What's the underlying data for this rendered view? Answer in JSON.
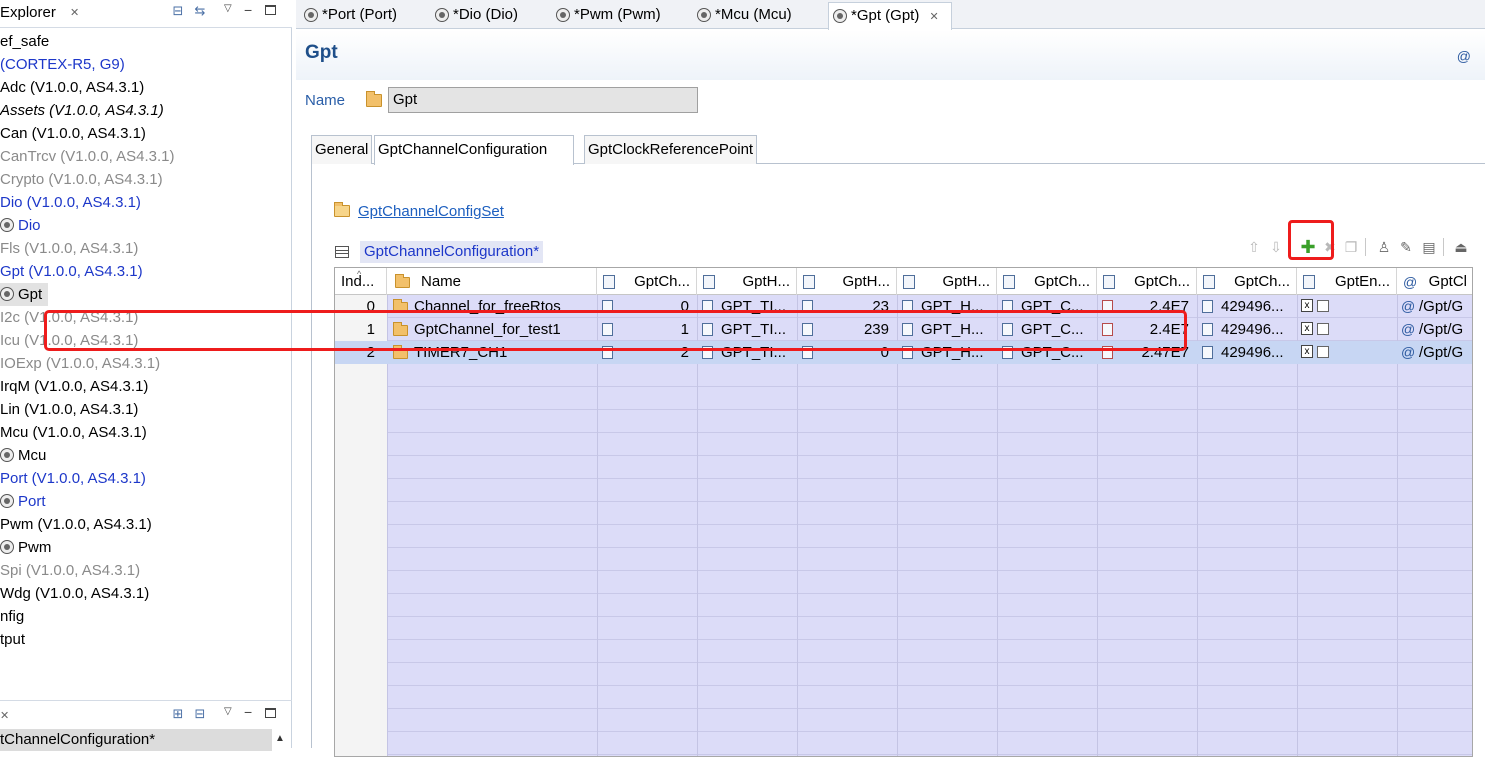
{
  "explorer": {
    "title": "Explorer",
    "items": [
      {
        "label": "ef_safe",
        "color": "black",
        "italic": false,
        "icon": false
      },
      {
        "label": " (CORTEX-R5, G9)",
        "color": "blue",
        "italic": false,
        "icon": false
      },
      {
        "label": "Adc (V1.0.0, AS4.3.1)",
        "color": "black",
        "italic": false,
        "icon": false
      },
      {
        "label": "Assets (V1.0.0, AS4.3.1)",
        "color": "black",
        "italic": true,
        "icon": false
      },
      {
        "label": "Can (V1.0.0, AS4.3.1)",
        "color": "black",
        "italic": false,
        "icon": false
      },
      {
        "label": "CanTrcv (V1.0.0, AS4.3.1)",
        "color": "gray",
        "italic": false,
        "icon": false
      },
      {
        "label": "Crypto (V1.0.0, AS4.3.1)",
        "color": "gray",
        "italic": false,
        "icon": false
      },
      {
        "label": "Dio (V1.0.0, AS4.3.1)",
        "color": "blue",
        "italic": false,
        "icon": false
      },
      {
        "label": "Dio",
        "color": "blue",
        "italic": false,
        "icon": true
      },
      {
        "label": "Fls (V1.0.0, AS4.3.1)",
        "color": "gray",
        "italic": false,
        "icon": false
      },
      {
        "label": "Gpt (V1.0.0, AS4.3.1)",
        "color": "blue",
        "italic": false,
        "icon": false
      },
      {
        "label": "Gpt",
        "color": "black",
        "italic": false,
        "icon": true,
        "selected": true
      },
      {
        "label": "I2c (V1.0.0, AS4.3.1)",
        "color": "gray",
        "italic": false,
        "icon": false
      },
      {
        "label": "Icu (V1.0.0, AS4.3.1)",
        "color": "gray",
        "italic": false,
        "icon": false
      },
      {
        "label": "IOExp (V1.0.0, AS4.3.1)",
        "color": "gray",
        "italic": false,
        "icon": false
      },
      {
        "label": "IrqM (V1.0.0, AS4.3.1)",
        "color": "black",
        "italic": false,
        "icon": false
      },
      {
        "label": "Lin (V1.0.0, AS4.3.1)",
        "color": "black",
        "italic": false,
        "icon": false
      },
      {
        "label": "Mcu (V1.0.0, AS4.3.1)",
        "color": "black",
        "italic": false,
        "icon": false
      },
      {
        "label": "Mcu",
        "color": "black",
        "italic": false,
        "icon": true
      },
      {
        "label": "Port (V1.0.0, AS4.3.1)",
        "color": "blue",
        "italic": false,
        "icon": false
      },
      {
        "label": "Port",
        "color": "blue",
        "italic": false,
        "icon": true
      },
      {
        "label": "Pwm (V1.0.0, AS4.3.1)",
        "color": "black",
        "italic": false,
        "icon": false
      },
      {
        "label": "Pwm",
        "color": "black",
        "italic": false,
        "icon": true
      },
      {
        "label": "Spi (V1.0.0, AS4.3.1)",
        "color": "gray",
        "italic": false,
        "icon": false
      },
      {
        "label": "Wdg (V1.0.0, AS4.3.1)",
        "color": "black",
        "italic": false,
        "icon": false
      },
      {
        "label": "nfig",
        "color": "black",
        "italic": false,
        "icon": false
      },
      {
        "label": "tput",
        "color": "black",
        "italic": false,
        "icon": false
      }
    ]
  },
  "outline": {
    "item": "tChannelConfiguration*"
  },
  "editor_tabs": [
    {
      "label": "*Port (Port)",
      "active": false
    },
    {
      "label": "*Dio (Dio)",
      "active": false
    },
    {
      "label": "*Pwm (Pwm)",
      "active": false
    },
    {
      "label": "*Mcu (Mcu)",
      "active": false
    },
    {
      "label": "*Gpt (Gpt)",
      "active": true
    }
  ],
  "editor": {
    "title": "Gpt",
    "at_icon": "@",
    "name_label": "Name",
    "name_value": "Gpt",
    "sub_tabs": [
      "General",
      "GptChannelConfiguration",
      "GptClockReferencePoint"
    ],
    "set_link": "GptChannelConfigSet",
    "section_title": "GptChannelConfiguration*",
    "toolbar": [
      "move-up-icon",
      "move-down-icon",
      "add-icon",
      "delete-icon",
      "copy-icon",
      "person-icon",
      "edit-icon",
      "form-icon",
      "export-icon"
    ]
  },
  "table": {
    "columns": [
      "Ind...",
      "Name",
      "GptCh...",
      "GptH...",
      "GptH...",
      "GptH...",
      "GptCh...",
      "GptCh...",
      "GptCh...",
      "GptEn...",
      "GptCl"
    ],
    "rows": [
      [
        "0",
        "Channel_for_freeRtos",
        "0",
        "GPT_TI...",
        "23",
        "GPT_H...",
        "GPT_C...",
        "2.4E7",
        "429496...",
        "",
        "/Gpt/G"
      ],
      [
        "1",
        "GptChannel_for_test1",
        "1",
        "GPT_TI...",
        "239",
        "GPT_H...",
        "GPT_C...",
        "2.4E7",
        "429496...",
        "",
        "/Gpt/G"
      ],
      [
        "2",
        "TIMER7_CH1",
        "2",
        "GPT_TI...",
        "0",
        "GPT_H...",
        "GPT_C...",
        "2.47E7",
        "429496...",
        "",
        "/Gpt/G"
      ]
    ],
    "selected_row": 2
  },
  "colors": {
    "accent_blue": "#1d37c9",
    "link_blue": "#1d5fbf",
    "highlight_red": "#ee1c1c",
    "table_bg": "#dcdcf8",
    "selected_row": "#c7d6f3"
  }
}
